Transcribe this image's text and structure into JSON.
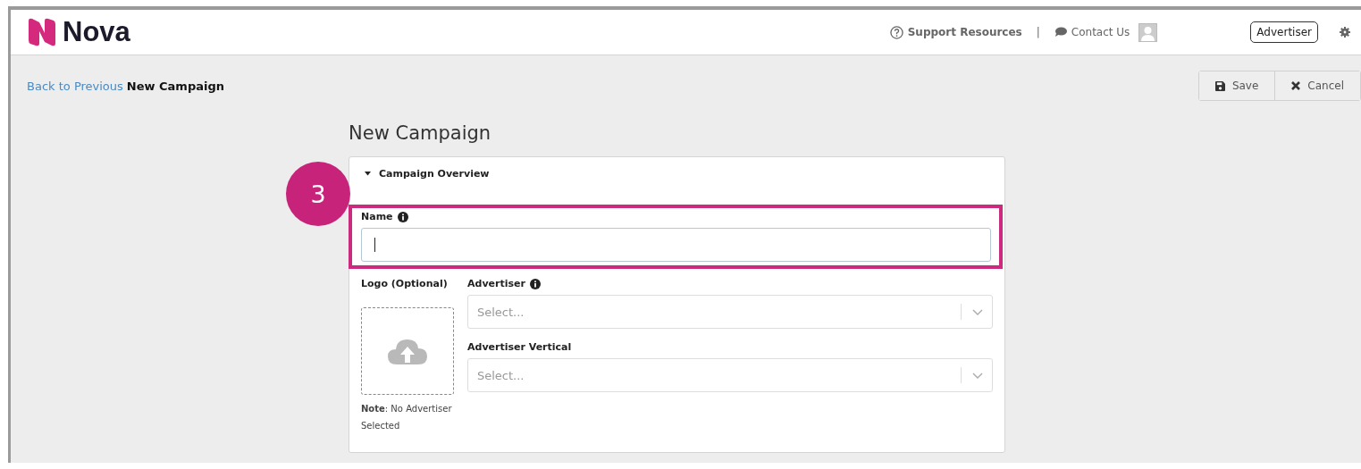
{
  "header": {
    "logo": "Nova",
    "links": [
      {
        "kind": "help",
        "label": "Support Resources"
      },
      {
        "kind": "chat",
        "label": "Contact Us"
      }
    ],
    "separator": "|",
    "role_button": "Advertiser"
  },
  "breadcrumb": {
    "back": "Back to Previous",
    "current": "New Campaign"
  },
  "actions": [
    {
      "kind": "save",
      "label": "Save"
    },
    {
      "kind": "cancel",
      "label": "Cancel"
    }
  ],
  "page_title": "New Campaign",
  "step_badge": "3",
  "section": {
    "title": "Campaign Overview",
    "expanded": true
  },
  "name_field": {
    "label": "Name",
    "focused": true
  },
  "logo": {
    "label": "Logo (Optional)",
    "note_bold": "Note",
    "note": ": No Advertiser Selected"
  },
  "selects": [
    {
      "label": "Advertiser",
      "info": true,
      "placeholder": "Select..."
    },
    {
      "label": "Advertiser Vertical",
      "info": false,
      "placeholder": "Select..."
    }
  ]
}
